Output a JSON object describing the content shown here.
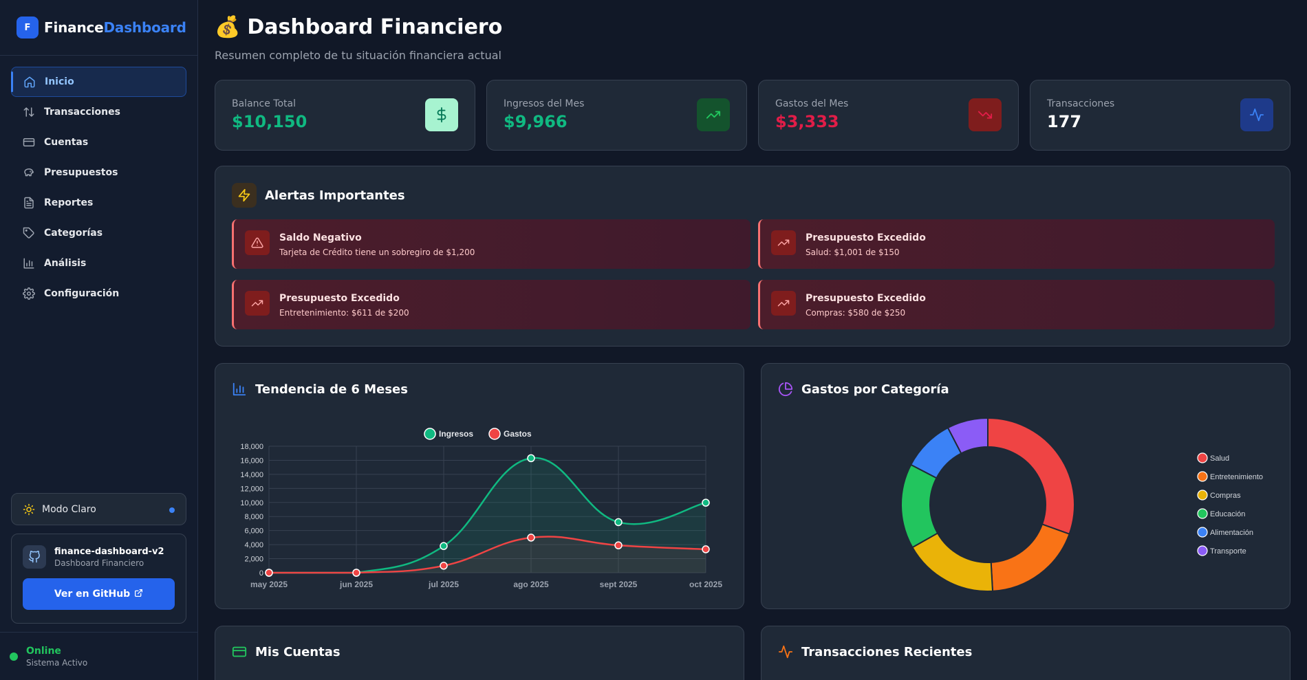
{
  "brand": {
    "logo_letter": "F",
    "name_part1": "Finance",
    "name_part2": "Dashboard"
  },
  "sidebar": {
    "items": [
      {
        "label": "Inicio",
        "icon": "home-icon",
        "active": true
      },
      {
        "label": "Transacciones",
        "icon": "arrows-up-down-icon"
      },
      {
        "label": "Cuentas",
        "icon": "credit-card-icon"
      },
      {
        "label": "Presupuestos",
        "icon": "piggy-bank-icon"
      },
      {
        "label": "Reportes",
        "icon": "file-text-icon"
      },
      {
        "label": "Categorías",
        "icon": "tag-icon"
      },
      {
        "label": "Análisis",
        "icon": "bar-chart-icon"
      },
      {
        "label": "Configuración",
        "icon": "gear-icon"
      }
    ],
    "theme_toggle_label": "Modo Claro",
    "repo": {
      "name": "finance-dashboard-v2",
      "subtitle": "Dashboard Financiero",
      "button_label": "Ver en GitHub"
    },
    "status": {
      "label": "Online",
      "sub": "Sistema Activo"
    }
  },
  "header": {
    "emoji": "💰",
    "title": "Dashboard Financiero",
    "subtitle": "Resumen completo de tu situación financiera actual"
  },
  "stats": [
    {
      "label": "Balance Total",
      "value": "$10,150",
      "color": "#10b981",
      "icon": "dollar-icon"
    },
    {
      "label": "Ingresos del Mes",
      "value": "$9,966",
      "color": "#10b981",
      "icon": "trending-up-icon"
    },
    {
      "label": "Gastos del Mes",
      "value": "$3,333",
      "color": "#e11d48",
      "icon": "trending-down-icon"
    },
    {
      "label": "Transacciones",
      "value": "177",
      "color": "#ffffff",
      "icon": "activity-icon"
    }
  ],
  "alerts": {
    "title": "Alertas Importantes",
    "items": [
      {
        "title": "Saldo Negativo",
        "text": "Tarjeta de Crédito tiene un sobregiro de $1,200",
        "icon": "warning-icon"
      },
      {
        "title": "Presupuesto Excedido",
        "text": "Salud: $1,001 de $150",
        "icon": "trending-up-icon"
      },
      {
        "title": "Presupuesto Excedido",
        "text": "Entretenimiento: $611 de $200",
        "icon": "trending-up-icon"
      },
      {
        "title": "Presupuesto Excedido",
        "text": "Compras: $580 de $250",
        "icon": "trending-up-icon"
      }
    ]
  },
  "trend": {
    "title": "Tendencia de 6 Meses"
  },
  "donut": {
    "title": "Gastos por Categoría"
  },
  "accounts": {
    "title": "Mis Cuentas"
  },
  "recent": {
    "title": "Transacciones Recientes"
  },
  "chart_data": [
    {
      "type": "line",
      "x": [
        "may 2025",
        "jun 2025",
        "jul 2025",
        "ago 2025",
        "sept 2025",
        "oct 2025"
      ],
      "series": [
        {
          "name": "Ingresos",
          "color": "#10b981",
          "values": [
            0,
            0,
            3800,
            16300,
            7200,
            9966
          ]
        },
        {
          "name": "Gastos",
          "color": "#ef4444",
          "values": [
            0,
            0,
            1000,
            5000,
            3900,
            3333
          ]
        }
      ],
      "ylim": [
        0,
        18000
      ],
      "yticks": [
        0,
        2000,
        4000,
        6000,
        8000,
        10000,
        12000,
        14000,
        16000,
        18000
      ],
      "legend": "top",
      "grid": true
    },
    {
      "type": "pie",
      "categories": [
        "Salud",
        "Entretenimiento",
        "Compras",
        "Educación",
        "Alimentación",
        "Transporte"
      ],
      "values": [
        1001,
        611,
        580,
        520,
        320,
        250
      ],
      "colors": [
        "#ef4444",
        "#f97316",
        "#eab308",
        "#22c55e",
        "#3b82f6",
        "#8b5cf6"
      ],
      "legend": "right"
    }
  ]
}
